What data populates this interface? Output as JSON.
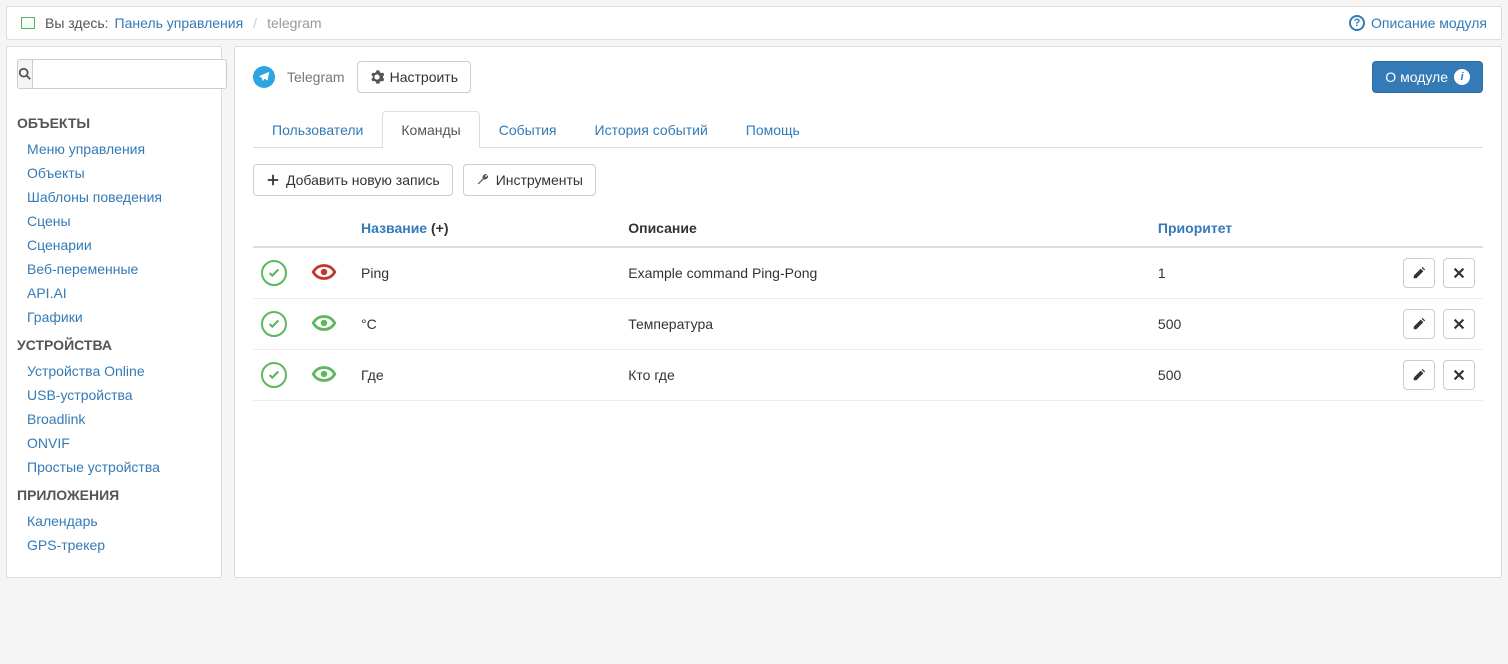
{
  "breadcrumb": {
    "label": "Вы здесь:",
    "home": "Панель управления",
    "current": "telegram"
  },
  "topright": {
    "help": "Описание модуля"
  },
  "sidebar": {
    "sections": [
      {
        "title": "ОБЪЕКТЫ",
        "items": [
          "Меню управления",
          "Объекты",
          "Шаблоны поведения",
          "Сцены",
          "Сценарии",
          "Веб-переменные",
          "API.AI",
          "Графики"
        ]
      },
      {
        "title": "УСТРОЙСТВА",
        "items": [
          "Устройства Online",
          "USB-устройства",
          "Broadlink",
          "ONVIF",
          "Простые устройства"
        ]
      },
      {
        "title": "ПРИЛОЖЕНИЯ",
        "items": [
          "Календарь",
          "GPS-трекер"
        ]
      }
    ]
  },
  "module": {
    "name": "Telegram",
    "configure": "Настроить",
    "about": "О модуле"
  },
  "tabs": [
    "Пользователи",
    "Команды",
    "События",
    "История событий",
    "Помощь"
  ],
  "activeTab": 1,
  "toolbar": {
    "add": "Добавить новую запись",
    "tools": "Инструменты"
  },
  "table": {
    "headers": {
      "name": "Название",
      "plus": "(+)",
      "desc": "Описание",
      "priority": "Приоритет"
    },
    "rows": [
      {
        "name": "Ping",
        "desc": "Example command Ping-Pong",
        "priority": "1",
        "eye": "red"
      },
      {
        "name": "°C",
        "desc": "Температура",
        "priority": "500",
        "eye": "green"
      },
      {
        "name": "Где",
        "desc": "Кто где",
        "priority": "500",
        "eye": "green"
      }
    ]
  }
}
